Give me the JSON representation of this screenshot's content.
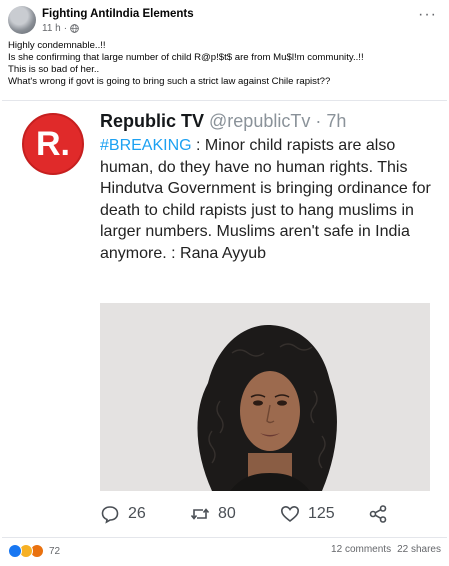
{
  "post": {
    "author": "Fighting AntiIndia Elements",
    "time": "11 h",
    "visibility_icon": "globe-icon",
    "caption_lines": [
      "Highly condemnable..!!",
      "Is she confirming that large number of child R@p!$t$  are  from Mu$l!m community..!!",
      "This is so bad of her..",
      "What's wrong if govt is going to bring such a strict law against Chile rapist??"
    ]
  },
  "shared_image": {
    "logo_text": "R.",
    "account_name": "Republic TV",
    "account_handle": "@republicTv · 7h",
    "hashtag": "#BREAKING",
    "tweet_text": " : Minor child rapists are also human, do they have no human rights. This Hindutva Government is bringing ordinance for death to child rapists just to hang muslims in larger numbers. Muslims aren't safe in India anymore. : Rana Ayyub",
    "replies": "26",
    "retweets": "80",
    "likes": "125"
  },
  "footer": {
    "reaction_count": "72",
    "comments": "12 comments",
    "shares": "22 shares"
  },
  "colors": {
    "facebook_blue": "#1877f2",
    "twitter_blue": "#1da1f2",
    "republic_red": "#e02a2a"
  }
}
